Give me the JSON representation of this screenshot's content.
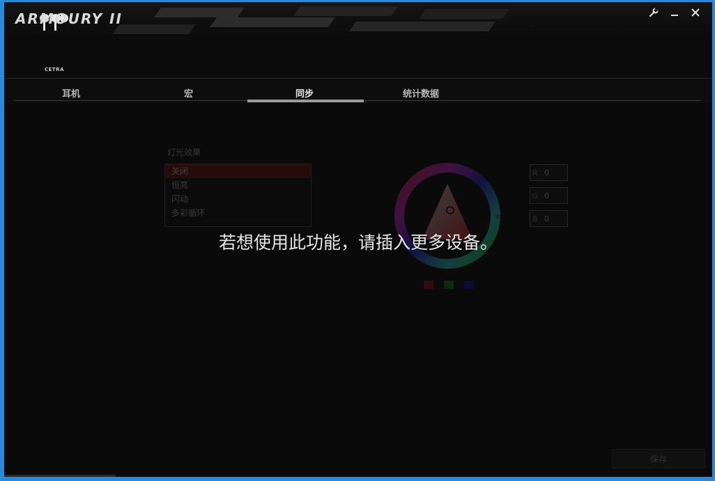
{
  "app": {
    "title": "ARMOURY II",
    "device_label": "CETRA",
    "window_controls": [
      "wrench-icon",
      "minimize-icon",
      "close-icon"
    ]
  },
  "tabs": [
    {
      "label": "耳机",
      "active": false
    },
    {
      "label": "宏",
      "active": false
    },
    {
      "label": "同步",
      "active": true
    },
    {
      "label": "统计数据",
      "active": false
    }
  ],
  "lighting": {
    "section_title": "灯光效果",
    "effects": [
      "关闭",
      "恒亮",
      "闪动",
      "多彩循环"
    ],
    "selected_effect": "关闭",
    "rgb_fields": [
      {
        "label": "R",
        "value": "0"
      },
      {
        "label": "G",
        "value": "0"
      },
      {
        "label": "B",
        "value": "0"
      }
    ],
    "swatch_colors": [
      "#c01515",
      "#14a014",
      "#1a1ac8"
    ]
  },
  "overlay_message": "若想使用此功能，请插入更多设备。",
  "footer": {
    "save_label": "保存"
  },
  "colors": {
    "background": "#0a0a0a",
    "selected_item": "#8a1010",
    "window_frame": "#2a8ad8"
  }
}
